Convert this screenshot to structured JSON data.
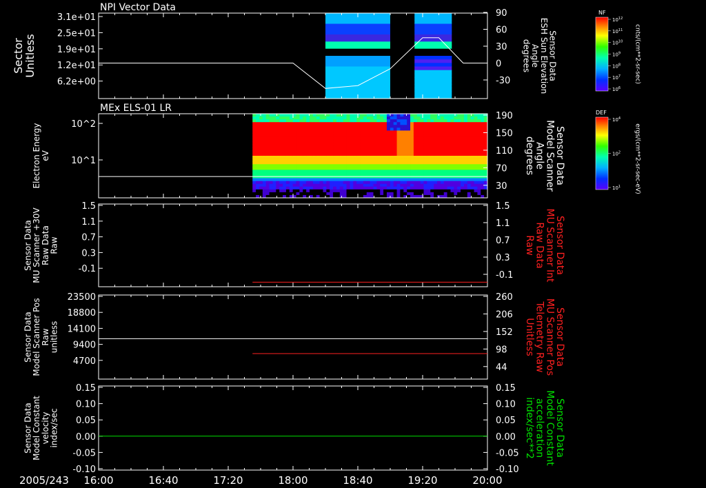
{
  "colors": {
    "background": "#000000",
    "axes": "#ffffff",
    "red_trace": "#ff2020",
    "green_trace": "#00e000"
  },
  "date_label": "2005/243",
  "x_ticks": [
    "16:00",
    "16:40",
    "17:20",
    "18:00",
    "18:40",
    "19:20",
    "20:00"
  ],
  "colorbars": [
    {
      "label": "NF",
      "tick_labels": [
        "10^12",
        "10^11",
        "10^10",
        "10^9",
        "10^8",
        "10^7",
        "10^6"
      ],
      "units": "cnts/(cm**2-sr-sec)"
    },
    {
      "label": "DEF",
      "tick_labels": [
        "10^4",
        "10^2",
        "10^1"
      ],
      "units": "ergs/(cm**2-sr-sec-eV)"
    }
  ],
  "chart_data": [
    {
      "type": "heatmap",
      "title": "NPI Vector Data",
      "left_label": [
        "Sector",
        "Unitless"
      ],
      "left_ticks": [
        "3.1e+01",
        "2.5e+01",
        "1.9e+01",
        "1.2e+01",
        "6.2e+00"
      ],
      "right_label": [
        "Sensor Data",
        "ESH Sun Elevation",
        "Angle",
        "degrees"
      ],
      "right_ticks": [
        "90",
        "60",
        "30",
        "0",
        "-30"
      ],
      "x_range": [
        "16:00",
        "20:00"
      ],
      "data_intervals": [
        [
          "18:20",
          "19:00"
        ],
        [
          "19:15",
          "19:38"
        ]
      ],
      "white_trace_time": [
        "16:00",
        "18:00",
        "18:20",
        "18:40",
        "19:00",
        "19:20",
        "19:30",
        "19:45",
        "20:00"
      ],
      "white_trace_deg": [
        0,
        0,
        -45,
        -40,
        -10,
        45,
        45,
        0,
        0
      ]
    },
    {
      "type": "heatmap",
      "title": "MEx ELS-01 LR",
      "left_label": [
        "Electron Energy",
        "eV"
      ],
      "left_ticks": [
        "10^2",
        "10^1"
      ],
      "right_label": [
        "Sensor Data",
        "Model Scanner",
        "Angle",
        "degrees"
      ],
      "right_ticks": [
        "190",
        "150",
        "110",
        "70",
        "30"
      ],
      "data_interval": [
        "17:35",
        "20:00"
      ],
      "white_trace_deg": 90
    },
    {
      "type": "line",
      "left_label": [
        "Sensor Data",
        "MU Scanner +30V",
        "Raw Data",
        "Raw"
      ],
      "left_ticks": [
        "1.5",
        "1.1",
        "0.7",
        "0.3",
        "-0.1"
      ],
      "right_label": [
        "Sensor Data",
        "MU Scanner Int",
        "Raw Data",
        "Raw"
      ],
      "right_ticks": [
        "1.5",
        "1.1",
        "0.7",
        "0.3",
        "-0.1"
      ],
      "ylim": [
        -0.3,
        1.5
      ],
      "series": [
        {
          "color": "red",
          "x": [
            "17:35",
            "20:00"
          ],
          "values": [
            -0.2,
            -0.2
          ]
        }
      ]
    },
    {
      "type": "line",
      "left_label": [
        "Sensor Data",
        "Model Scanner Pos",
        "Raw",
        "unitless"
      ],
      "left_ticks": [
        "23500",
        "18800",
        "14100",
        "9400",
        "4700"
      ],
      "right_label": [
        "Sensor Data",
        "MU Scanner Pos",
        "Telemetry Raw",
        "Unitless"
      ],
      "right_ticks": [
        "260",
        "206",
        "152",
        "98",
        "44"
      ],
      "ylim": [
        0,
        23500
      ],
      "series": [
        {
          "color": "white",
          "x": [
            "16:00",
            "20:00"
          ],
          "values": [
            11300,
            11300
          ]
        },
        {
          "color": "red",
          "x": [
            "17:35",
            "20:00"
          ],
          "values": [
            85,
            85
          ]
        }
      ]
    },
    {
      "type": "line",
      "left_label": [
        "Sensor Data",
        "Model Constant",
        "velocity",
        "index/sec"
      ],
      "left_ticks": [
        "0.15",
        "0.10",
        "0.05",
        "0.00",
        "-0.05",
        "-0.10"
      ],
      "right_label": [
        "Sensor Data",
        "Model Constant",
        "acceleration",
        "index/sec**2"
      ],
      "right_ticks": [
        "0.15",
        "0.10",
        "0.05",
        "0.00",
        "-0.05",
        "-0.10"
      ],
      "ylim": [
        -0.1,
        0.15
      ],
      "series": [
        {
          "color": "green",
          "x": [
            "16:00",
            "20:00"
          ],
          "values": [
            0.0,
            0.0
          ]
        }
      ]
    }
  ]
}
